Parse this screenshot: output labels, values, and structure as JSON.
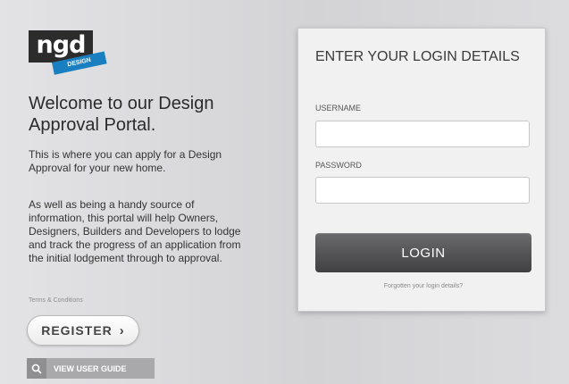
{
  "logo": {
    "text": "ngd",
    "tag": "DESIGN"
  },
  "welcome": {
    "heading": "Welcome to our Design Approval Portal.",
    "intro": "This is where you can apply for a Design Approval for your new home.",
    "body": "As well as being a handy source of information, this portal will help Owners, Designers, Builders and Developers to lodge and track the progress of an application from the initial lodgement through to approval.",
    "terms_link": "Terms & Conditions"
  },
  "actions": {
    "register_label": "REGISTER",
    "user_guide_label": "VIEW USER GUIDE"
  },
  "login": {
    "title": "ENTER YOUR LOGIN DETAILS",
    "username_label": "USERNAME",
    "username_value": "",
    "password_label": "PASSWORD",
    "password_value": "",
    "button_label": "LOGIN",
    "forgot_link": "Forgotten your login details?"
  }
}
